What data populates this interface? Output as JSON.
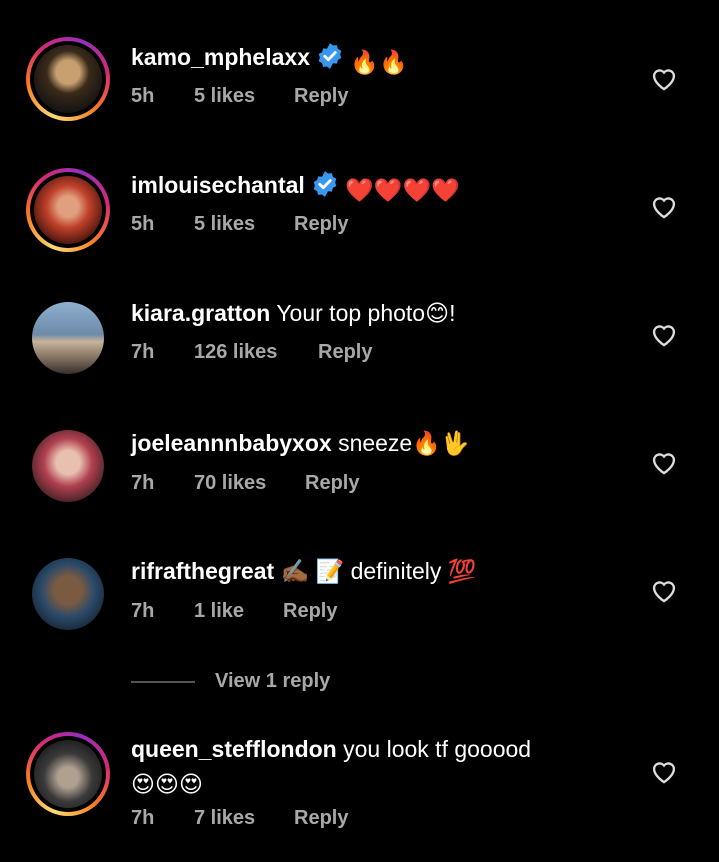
{
  "comments": [
    {
      "username": "kamo_mphelaxx",
      "verified": true,
      "text": "",
      "emojis": "🔥🔥",
      "time": "5h",
      "likes": "5 likes",
      "reply": "Reply",
      "ring": true,
      "avatar_colors": [
        "#3a2a1a",
        "#c8a070"
      ]
    },
    {
      "username": "imlouisechantal",
      "verified": true,
      "text": "",
      "emojis": "❤️❤️❤️❤️",
      "time": "5h",
      "likes": "5 likes",
      "reply": "Reply",
      "ring": true,
      "avatar_colors": [
        "#5a1a10",
        "#d0603a"
      ]
    },
    {
      "username": "kiara.gratton",
      "verified": false,
      "text": "Your top photo😊!",
      "emojis": "",
      "time": "7h",
      "likes": "126 likes",
      "reply": "Reply",
      "ring": false,
      "avatar_colors": [
        "#6d8aa8",
        "#c9b39a"
      ]
    },
    {
      "username": "joeleannnbabyxox",
      "verified": false,
      "text": "sneeze🔥🖖",
      "emojis": "",
      "time": "7h",
      "likes": "70 likes",
      "reply": "Reply",
      "ring": false,
      "avatar_colors": [
        "#8a3040",
        "#e0b0a0"
      ]
    },
    {
      "username": "rifrafthegreat",
      "verified": false,
      "text": "✍🏾 📝 definitely 💯",
      "emojis": "",
      "time": "7h",
      "likes": "1 like",
      "reply": "Reply",
      "ring": false,
      "avatar_colors": [
        "#2a4a6a",
        "#7a5a40"
      ]
    },
    {
      "username": "queen_stefflondon",
      "verified": false,
      "text": "you look tf gooood",
      "emojis": "😍😍😍",
      "time": "7h",
      "likes": "7 likes",
      "reply": "Reply",
      "ring": true,
      "avatar_colors": [
        "#3a3a3a",
        "#b0a090"
      ]
    }
  ],
  "view_replies_label": "View 1 reply",
  "colors": {
    "background": "#000000",
    "meta_text": "#a8a8a8",
    "verified_blue": "#3897f0"
  },
  "icons": {
    "like": "heart-outline-icon",
    "verified": "verified-badge-icon"
  }
}
